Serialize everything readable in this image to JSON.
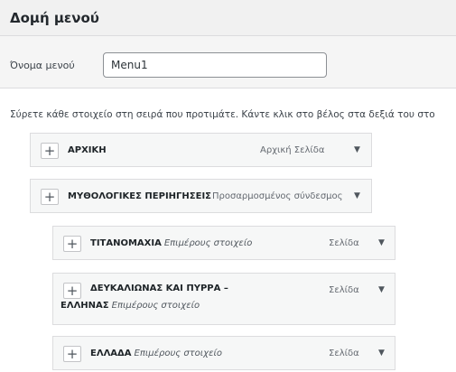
{
  "section": {
    "title": "Δομή μενού"
  },
  "menu_name": {
    "label": "Όνομα μενού",
    "value": "Menu1"
  },
  "instructions": "Σύρετε κάθε στοιχείο στη σειρά που προτιμάτε. Κάντε κλικ στο βέλος στα δεξιά του στο",
  "icons": {
    "add": "plus-icon",
    "expand": "triangle-down-icon"
  },
  "icon_glyphs": {
    "plus": "+",
    "arrow": "▼"
  },
  "items": [
    {
      "title": "ΑΡΧΙΚΗ",
      "subtitle": "",
      "type": "Αρχική Σελίδα"
    },
    {
      "title": "ΜΥΘΟΛΟΓΙΚΕΣ ΠΕΡΙΗΓΗΣΕΙΣ",
      "subtitle": "",
      "type": "Προσαρμοσμένος σύνδεσμος"
    },
    {
      "title": "ΤΙΤΑΝΟΜΑΧΙΑ",
      "subtitle": "Επιμέρους στοιχείο",
      "type": "Σελίδα"
    },
    {
      "title": "ΔΕΥΚΑΛΙΩΝΑΣ ΚΑΙ ΠΥΡΡΑ – ΕΛΛΗΝΑΣ",
      "subtitle": "Επιμέρους στοιχείο",
      "type": "Σελίδα"
    },
    {
      "title": "ΕΛΛΑΔΑ",
      "subtitle": "Επιμέρους στοιχείο",
      "type": "Σελίδα"
    }
  ]
}
